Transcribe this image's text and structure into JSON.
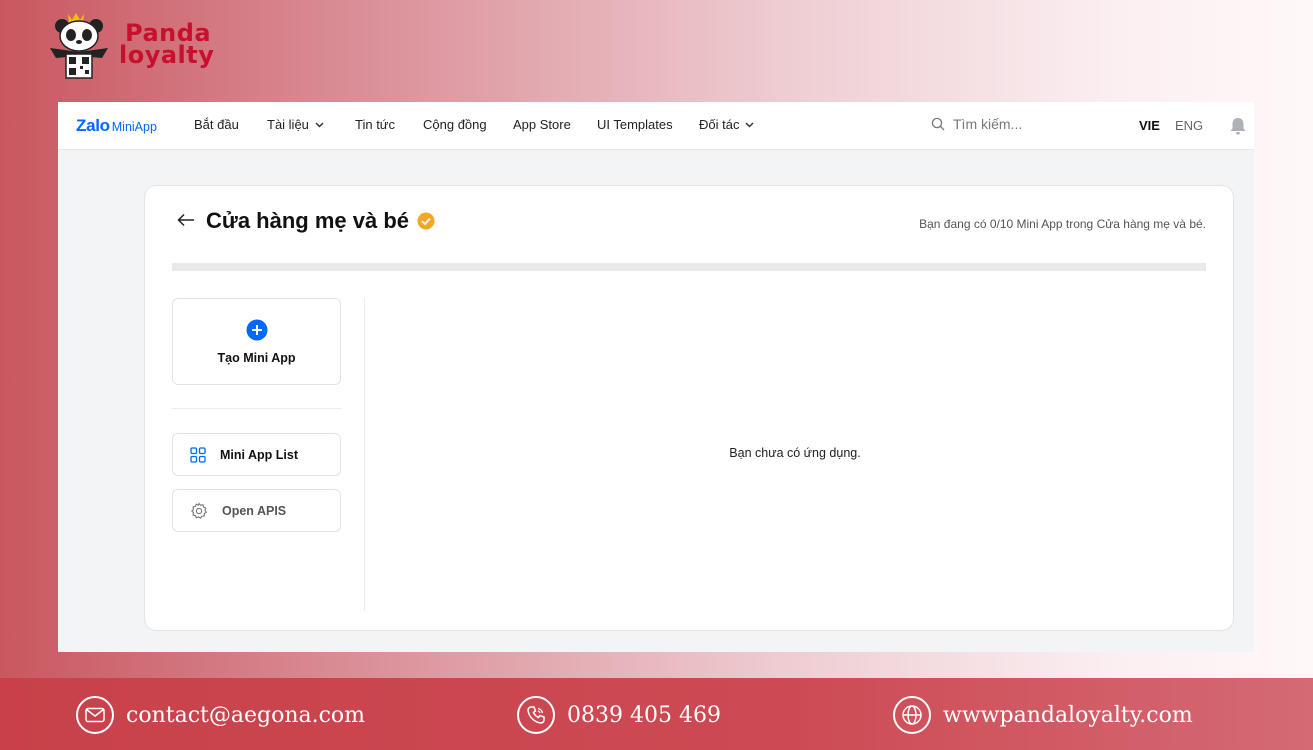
{
  "brand": {
    "line1": "Panda",
    "line2": "loyalty"
  },
  "nav": {
    "logo_main": "Zalo",
    "logo_sub": "MiniApp",
    "items": [
      {
        "label": "Bắt đầu"
      },
      {
        "label": "Tài liệu"
      },
      {
        "label": "Tin tức"
      },
      {
        "label": "Cộng đồng"
      },
      {
        "label": "App Store"
      },
      {
        "label": "UI Templates"
      },
      {
        "label": "Đối tác"
      }
    ],
    "search_placeholder": "Tìm kiếm...",
    "lang_vie": "VIE",
    "lang_eng": "ENG",
    "icons": {
      "search": "search-icon",
      "bell": "bell-icon",
      "dropdown": "chevron-down-icon"
    }
  },
  "page": {
    "title": "Cửa hàng mẹ và bé",
    "quota_text": "Bạn đang có 0/10 Mini App trong Cửa hàng mẹ và bé.",
    "quota_progress": 0,
    "create_label": "Tạo Mini App",
    "menu": [
      {
        "label": "Mini App List",
        "icon": "grid-icon"
      },
      {
        "label": "Open APIS",
        "icon": "gear-icon"
      }
    ],
    "empty_text": "Bạn chưa có ứng dụng."
  },
  "footer": {
    "email": "contact@aegona.com",
    "phone": "0839 405 469",
    "website": "wwwpandaloyalty.com"
  },
  "colors": {
    "accent": "#0068ff",
    "verified": "#f5a623",
    "footer": "#c8414a",
    "brand": "#c8102e"
  }
}
